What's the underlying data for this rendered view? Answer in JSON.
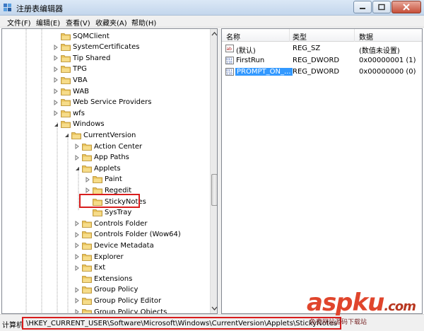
{
  "window": {
    "title": "注册表编辑器"
  },
  "menu": [
    {
      "label": "文件(F)"
    },
    {
      "label": "编辑(E)"
    },
    {
      "label": "查看(V)"
    },
    {
      "label": "收藏夹(A)"
    },
    {
      "label": "帮助(H)"
    }
  ],
  "tree": {
    "items": [
      {
        "label": "SQMClient",
        "depth": 1,
        "expander": "none"
      },
      {
        "label": "SystemCertificates",
        "depth": 1,
        "expander": "collapsed"
      },
      {
        "label": "Tip Shared",
        "depth": 1,
        "expander": "collapsed"
      },
      {
        "label": "TPG",
        "depth": 1,
        "expander": "collapsed"
      },
      {
        "label": "VBA",
        "depth": 1,
        "expander": "collapsed"
      },
      {
        "label": "WAB",
        "depth": 1,
        "expander": "collapsed"
      },
      {
        "label": "Web Service Providers",
        "depth": 1,
        "expander": "collapsed"
      },
      {
        "label": "wfs",
        "depth": 1,
        "expander": "collapsed"
      },
      {
        "label": "Windows",
        "depth": 1,
        "expander": "expanded"
      },
      {
        "label": "CurrentVersion",
        "depth": 2,
        "expander": "expanded"
      },
      {
        "label": "Action Center",
        "depth": 3,
        "expander": "collapsed"
      },
      {
        "label": "App Paths",
        "depth": 3,
        "expander": "collapsed"
      },
      {
        "label": "Applets",
        "depth": 3,
        "expander": "expanded"
      },
      {
        "label": "Paint",
        "depth": 4,
        "expander": "collapsed"
      },
      {
        "label": "Regedit",
        "depth": 4,
        "expander": "collapsed"
      },
      {
        "label": "StickyNotes",
        "depth": 4,
        "expander": "none",
        "selected": true
      },
      {
        "label": "SysTray",
        "depth": 4,
        "expander": "none"
      },
      {
        "label": "Controls Folder",
        "depth": 3,
        "expander": "collapsed"
      },
      {
        "label": "Controls Folder (Wow64)",
        "depth": 3,
        "expander": "collapsed"
      },
      {
        "label": "Device Metadata",
        "depth": 3,
        "expander": "collapsed"
      },
      {
        "label": "Explorer",
        "depth": 3,
        "expander": "collapsed"
      },
      {
        "label": "Ext",
        "depth": 3,
        "expander": "collapsed"
      },
      {
        "label": "Extensions",
        "depth": 3,
        "expander": "none"
      },
      {
        "label": "Group Policy",
        "depth": 3,
        "expander": "collapsed"
      },
      {
        "label": "Group Policy Editor",
        "depth": 3,
        "expander": "collapsed"
      },
      {
        "label": "Group Policy Objects",
        "depth": 3,
        "expander": "collapsed"
      }
    ]
  },
  "list": {
    "headers": {
      "name": "名称",
      "type": "类型",
      "data": "数据"
    },
    "rows": [
      {
        "name": "(默认)",
        "type": "REG_SZ",
        "data": "(数值未设置)",
        "icon": "string-value-icon"
      },
      {
        "name": "FirstRun",
        "type": "REG_DWORD",
        "data": "0x00000001 (1)",
        "icon": "dword-value-icon"
      },
      {
        "name": "PROMPT_ON_...",
        "type": "REG_DWORD",
        "data": "0x00000000 (0)",
        "icon": "dword-value-icon",
        "selected": true
      }
    ]
  },
  "status": {
    "prefix": "计算机",
    "path": "\\HKEY_CURRENT_USER\\Software\\Microsoft\\Windows\\CurrentVersion\\Applets\\StickyNotes"
  },
  "watermark": {
    "brand": "aspku",
    "brand_suffix": ".com",
    "tagline": "免费网站源码下载站"
  },
  "colors": {
    "selection": "#3399ff",
    "annotation_red": "#d81d1d",
    "folder": "#e8c25a"
  }
}
